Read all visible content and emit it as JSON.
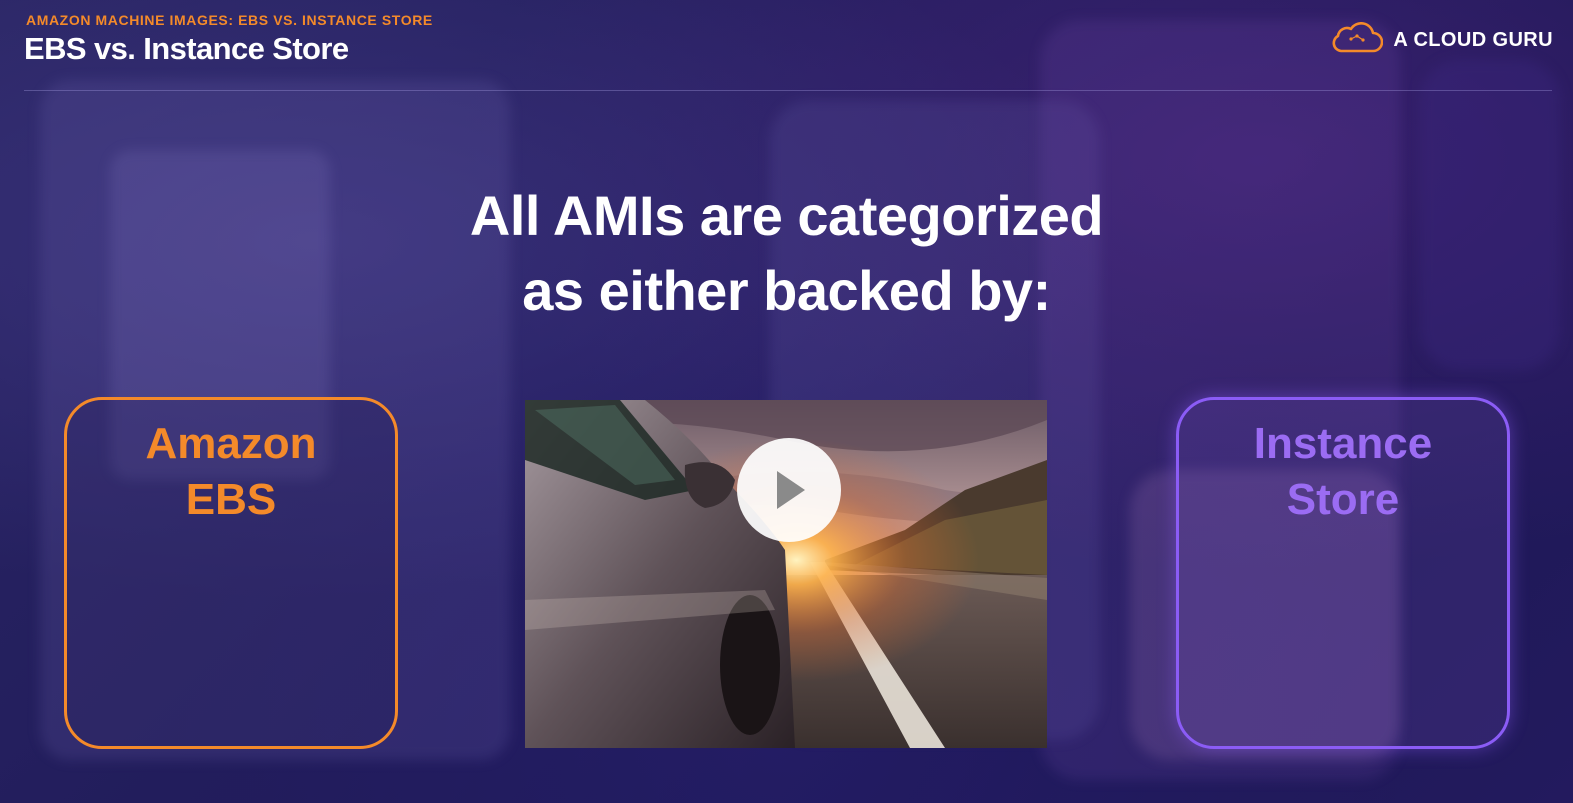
{
  "header": {
    "section_label": "AMAZON MACHINE IMAGES: EBS VS. INSTANCE STORE",
    "title": "EBS vs. Instance Store"
  },
  "brand": {
    "name": "A CLOUD GURU",
    "icon": "cloud-logo-icon",
    "accent_color": "#f48a2a"
  },
  "main": {
    "headline_line1": "All AMIs are categorized",
    "headline_line2": "as either backed by:"
  },
  "cards": {
    "ebs": {
      "line1": "Amazon",
      "line2": "EBS",
      "color": "#f48a2a"
    },
    "instance_store": {
      "line1": "Instance",
      "line2": "Store",
      "color": "#8b5cf6"
    }
  },
  "video": {
    "thumbnail": "car-on-road-at-sunset",
    "play_icon": "play-icon"
  }
}
